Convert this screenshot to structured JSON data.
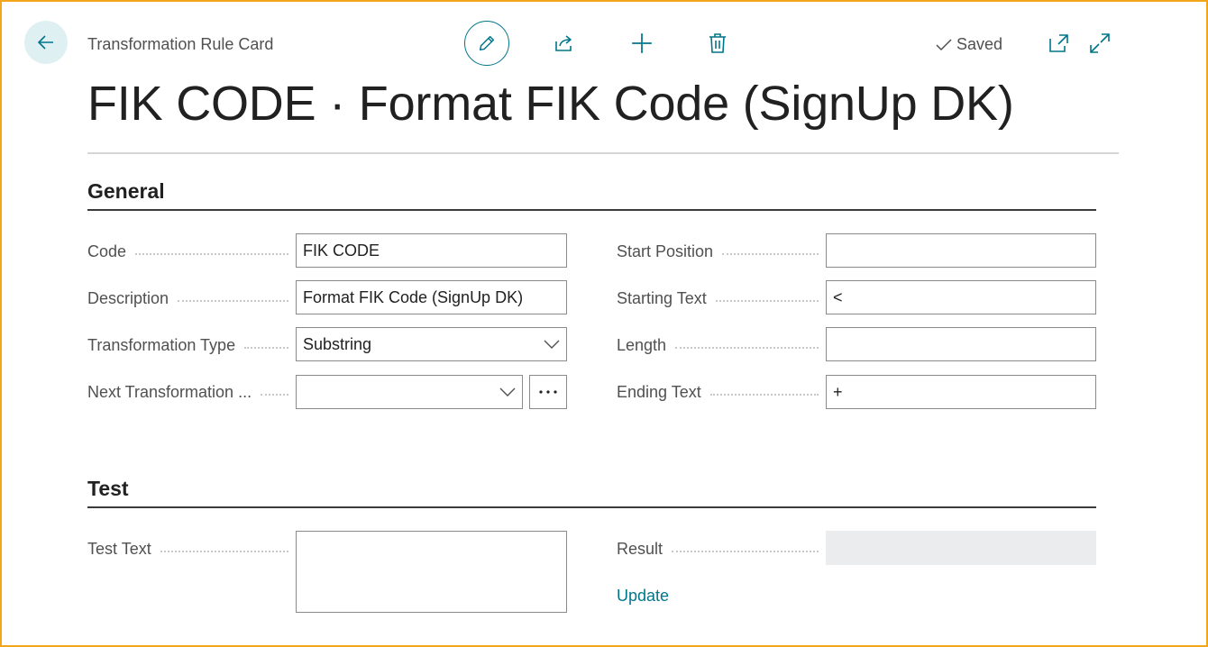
{
  "header": {
    "caption": "Transformation Rule Card",
    "saved_label": "Saved",
    "title": "FIK CODE · Format FIK Code (SignUp DK)"
  },
  "icons": [
    "back-arrow-icon",
    "pencil-icon",
    "share-icon",
    "plus-icon",
    "trash-icon",
    "checkmark-icon",
    "open-new-window-icon",
    "expand-icon",
    "chevron-down-icon",
    "ellipsis-icon"
  ],
  "colors": {
    "accent": "#00768a",
    "frame": "#f3a619",
    "result_bg": "#ebecee"
  },
  "general": {
    "title": "General",
    "code_label": "Code",
    "code_value": "FIK CODE",
    "description_label": "Description",
    "description_value": "Format FIK Code (SignUp DK)",
    "transformation_type_label": "Transformation Type",
    "transformation_type_value": "Substring",
    "next_transformation_label": "Next Transformation ...",
    "next_transformation_value": "",
    "start_position_label": "Start Position",
    "start_position_value": "",
    "starting_text_label": "Starting Text",
    "starting_text_value": "<",
    "length_label": "Length",
    "length_value": "",
    "ending_text_label": "Ending Text",
    "ending_text_value": "+"
  },
  "test": {
    "title": "Test",
    "test_text_label": "Test Text",
    "test_text_value": "",
    "result_label": "Result",
    "result_value": "",
    "update_link": "Update"
  }
}
